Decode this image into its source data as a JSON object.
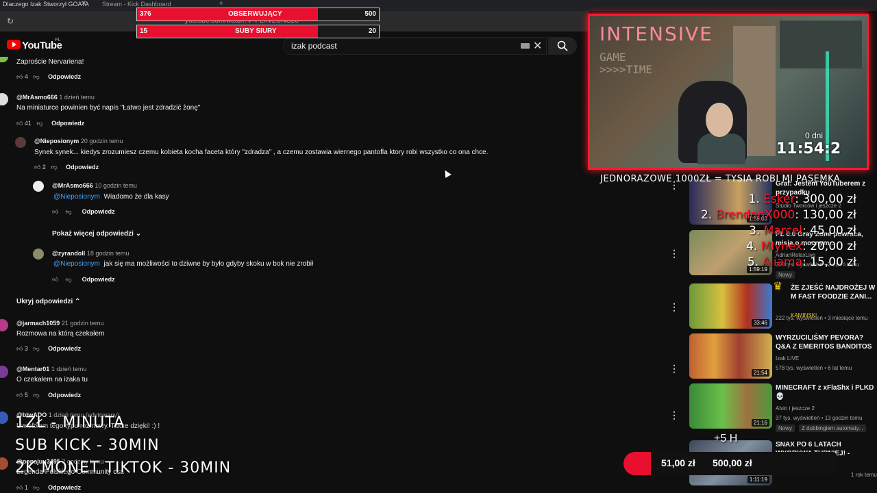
{
  "browser": {
    "tabs": [
      "Dlaczego Izak Stworzył GOATA",
      "Stream - Kick Dashboard"
    ],
    "url": "youtube.com/watch?v=PLhVZUNC2o"
  },
  "youtube": {
    "logo_text": "YouTube",
    "region": "PL",
    "search_value": "izak podcast"
  },
  "goal_bars": [
    {
      "left_value": "376",
      "label": "OBSERWUJĄCY",
      "right_value": "500",
      "progress": 0.752
    },
    {
      "left_value": "15",
      "label": "SUBY SIURY",
      "right_value": "20",
      "progress": 0.75
    }
  ],
  "comments": [
    {
      "text": "Zaproście Nervariena!",
      "likes": "4",
      "reply": "Odpowiedz"
    },
    {
      "author": "@MrAsmo666",
      "time": "1 dzień temu",
      "text": "Na miniaturce powinien być napis \"Łatwo jest zdradzić żonę\"",
      "likes": "41",
      "reply": "Odpowiedz"
    },
    {
      "author": "@Nieposionym",
      "time": "20 godzin temu",
      "text": "Synek synek... kiedys zrozumiesz czemu kobieta kocha faceta który \"zdradza\" , a czemu zostawia wiernego pantofla ktory robi wszystko co ona chce.",
      "likes": "2",
      "reply": "Odpowiedz"
    },
    {
      "author": "@MrAsmo666",
      "time": "10 godzin temu",
      "mention": "@Nieposionym",
      "text": "Wiadomo że dla kasy",
      "reply": "Odpowiedz"
    },
    {
      "author": "@zyrandoll",
      "time": "18 godzin temu",
      "mention": "@Nieposionym",
      "text": "jak się ma możliwości to dziwne by było gdyby skoku w bok nie zrobił",
      "reply": "Odpowiedz"
    },
    {
      "author": "@jarmach1059",
      "time": "21 godzin temu",
      "text": "Rozmowa na którą czekałem",
      "likes": "3",
      "reply": "Odpowiedz"
    },
    {
      "author": "@Mentar01",
      "time": "1 dzień temu",
      "text": "O czekałem na izaka tu",
      "likes": "5",
      "reply": "Odpowiedz"
    },
    {
      "author": "@btwADO",
      "time": "1 dzień temu (edytowany)",
      "text": "Uwielbiam tego typu rozmowy. Także dzięki! :) !"
    },
    {
      "author": "@popajuu3495",
      "time": "2 godziny temu",
      "text": "Legenda Polskiego Community csa",
      "likes": "1",
      "reply": "Odpowiedz"
    }
  ],
  "show_more_replies": "Pokaż więcej odpowiedzi",
  "hide_replies": "Ukryj odpowiedzi",
  "stream_overlay": {
    "cam_label": "INTENSIVE",
    "wall_sign": "GAME\n>>>>TIME",
    "timer_days": "0 dni",
    "timer": "11:54:2",
    "banner": "JEDNORAZOWE 1000ZŁ = TYSIA ROBI MI PASEMKA",
    "top_donors": [
      {
        "rank": "1.",
        "name": "Esker",
        "amount": "300,00 zł"
      },
      {
        "rank": "2.",
        "name": "BrendonX000",
        "amount": "130,00 zł"
      },
      {
        "rank": "3.",
        "name": "Marcel",
        "amount": "45,00 zł"
      },
      {
        "rank": "4.",
        "name": "Mlynex",
        "amount": "20,00 zł"
      },
      {
        "rank": "5.",
        "name": "Aliama",
        "amount": "15,00 zł"
      }
    ],
    "rules": [
      "1ZŁ - MINUTA",
      "SUB KICK - 30MIN",
      "2K MONET TIKTOK - 30MIN"
    ],
    "goal_current": "51,00 zł",
    "goal_target": "500,00 zł",
    "goal_label": "+5 H"
  },
  "sidebar_videos": [
    {
      "title": "Graf: Jestem YouTuberem z przypadku",
      "channel": "Studio Tworców i jeszcze 2",
      "duration": "1:59:03"
    },
    {
      "title": "PL 6.0 Gray Zone powraca, misja o mocnym...",
      "channel": "AdrianRelaxLive",
      "meta": "203 tys. wyświetleń • 2 dzień temu",
      "duration": "1:59:19",
      "badge": "Nowy"
    },
    {
      "title": "ŻE ZJEŚĆ NAJDROŻEJ W M FAST FOODZIE ZANI...",
      "channel": "KAMINSKI",
      "meta": "222 tys. wyświetleń • 3 miesiące temu",
      "duration": "33:46"
    },
    {
      "title": "WYRZUCILIŚMY PEVORA? Q&A Z EMERITOS BANDITOS",
      "channel": "Izak LIVE",
      "meta": "578 tys. wyświetleń • 6 lat temu",
      "duration": "21:54"
    },
    {
      "title": "MINECRAFT z xFlaShx i PLKD 💀",
      "channel": "Alvin i jeszcze 2",
      "meta": "37 tys. wyświetleń • 13 godzin temu",
      "duration": "21:16",
      "badge": "Nowy",
      "badge2": "Z dubbingiem automaty..."
    },
    {
      "title": "SNAX PO 6 LATACH WYGRYWA TURNIEJ! - KLĄTWA...",
      "channel": "",
      "meta": "1 rok temu",
      "duration": "1:11:19"
    }
  ]
}
